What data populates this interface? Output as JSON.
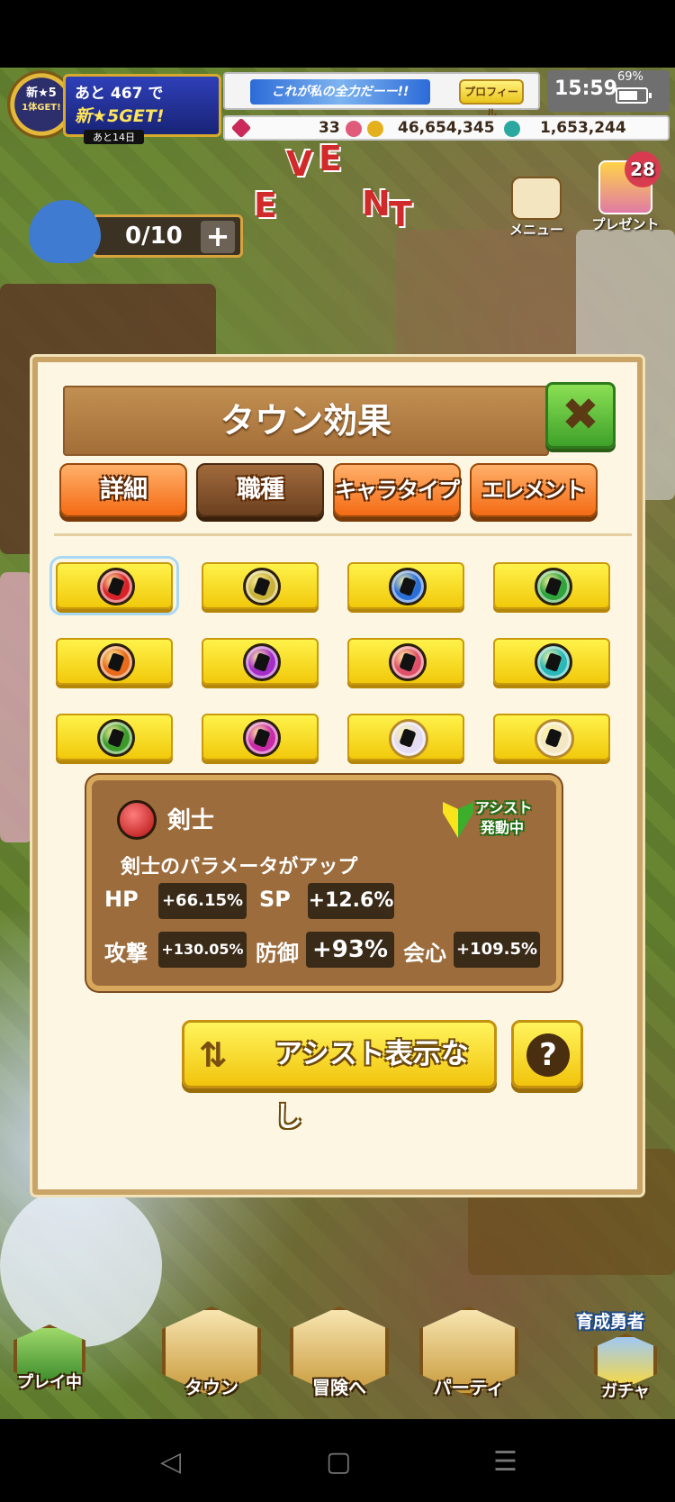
{
  "hud": {
    "new_star": "新★5",
    "new_star_sub": "1体GET!",
    "gacha_line1": "あと 467 で",
    "gacha_line2": "新★5GET!",
    "gacha_line3": "あと14日",
    "profile_message": "これが私の全力だーー!!",
    "profile_button": "プロフィール",
    "clock": "15:59",
    "battery": "69%",
    "gems": "33",
    "coins": "46,654,345",
    "drops": "1,653,244",
    "stamina": "0/10",
    "stamina_plus": "+",
    "event_letters": [
      "E",
      "V",
      "E",
      "N",
      "T"
    ],
    "menu_label": "メニュー",
    "present_label": "プレゼント",
    "present_badge": "28"
  },
  "modal": {
    "title": "タウン効果",
    "close": "✖",
    "tabs": [
      {
        "label": "詳細",
        "active": false
      },
      {
        "label": "職種",
        "active": true
      },
      {
        "label": "キャラタイプ",
        "active": false
      },
      {
        "label": "エレメント",
        "active": false
      }
    ],
    "job_icons": [
      {
        "name": "sword-icon",
        "color": "#d8222a"
      },
      {
        "name": "fist-icon",
        "color": "#c9b23a"
      },
      {
        "name": "axe-icon",
        "color": "#2a6ed8"
      },
      {
        "name": "spear-icon",
        "color": "#2fa33c"
      },
      {
        "name": "bow-icon",
        "color": "#e86a1a"
      },
      {
        "name": "staff-icon",
        "color": "#a52ec9"
      },
      {
        "name": "dual-blade-icon",
        "color": "#e0506a"
      },
      {
        "name": "wing-icon",
        "color": "#2ab8b8"
      },
      {
        "name": "claw-icon",
        "color": "#3c9a2a"
      },
      {
        "name": "hammer-icon",
        "color": "#c92aa8"
      },
      {
        "name": "special-mark-icon",
        "color": "#e4dcf4"
      },
      {
        "name": "secret-mark-icon",
        "color": "#f4e8c4"
      }
    ],
    "info": {
      "name": "剣士",
      "assist_line1": "アシスト",
      "assist_line2": "発動中",
      "description": "剣士のパラメータがアップ",
      "hp_label": "HP",
      "hp_value": "+66.15%",
      "sp_label": "SP",
      "sp_value": "+12.6%",
      "atk_label": "攻撃",
      "atk_value": "+130.05%",
      "def_label": "防御",
      "def_value": "+93%",
      "crit_label": "会心",
      "crit_value": "+109.5%"
    },
    "assist_toggle": "アシスト表示なし",
    "help": "?"
  },
  "bottom_nav": {
    "play": "プレイ中",
    "town": "タウン",
    "adventure": "冒険へ",
    "party": "パーティ",
    "gacha": "ガチャ",
    "ikusei": "育成勇者"
  },
  "system_nav": {
    "back": "◁",
    "home": "▢",
    "recent": "☰"
  }
}
